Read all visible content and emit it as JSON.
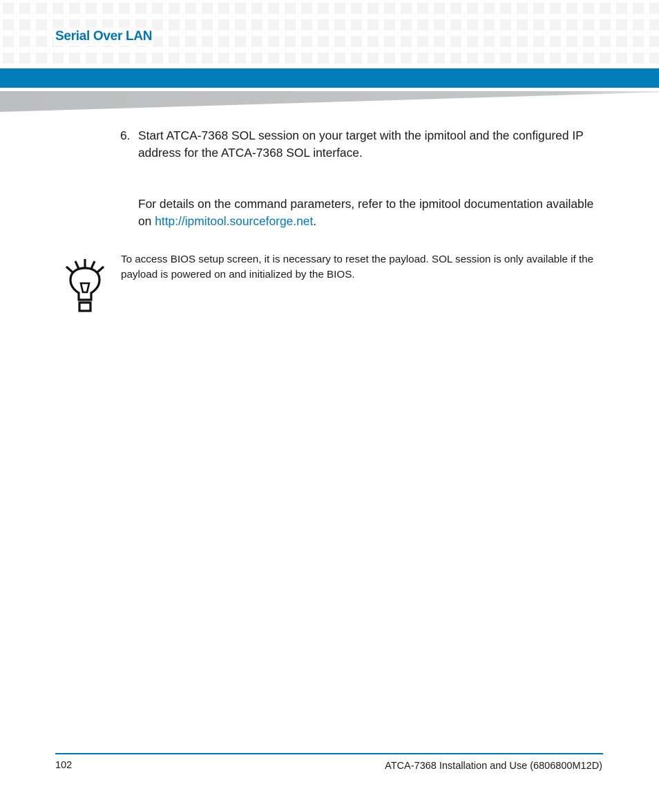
{
  "header": {
    "chapter_title": "Serial Over LAN",
    "accent_color": "#007dba"
  },
  "body": {
    "step": {
      "number": "6.",
      "text": "Start ATCA-7368 SOL session on your target with the ipmitool and the configured IP address for the ATCA-7368 SOL interface."
    },
    "paragraph": {
      "prefix": "For details on the command parameters, refer to the ipmitool documentation available on ",
      "link_text": "http://ipmitool.sourceforge.net",
      "suffix": "."
    },
    "note": {
      "icon": "lightbulb-icon",
      "text": "To access BIOS setup screen, it is necessary to reset the payload. SOL session is only available if the payload is powered on and initialized by the BIOS."
    }
  },
  "footer": {
    "page_number": "102",
    "document_title": "ATCA-7368 Installation and Use (6806800M12D)"
  }
}
